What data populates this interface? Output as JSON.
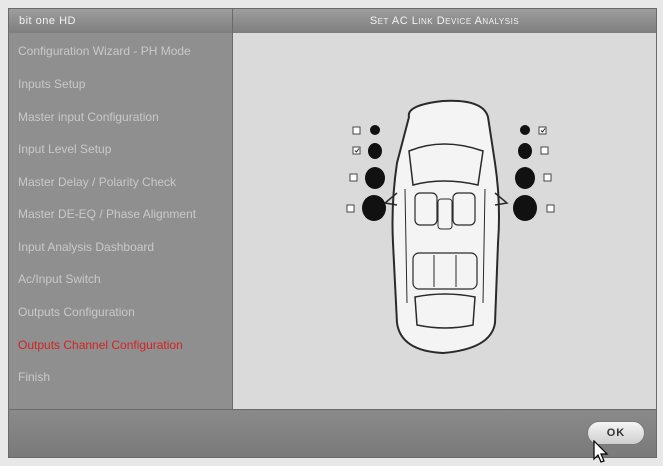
{
  "app": {
    "name": "bit one HD"
  },
  "window": {
    "title": "Set AC Link Device Analysis"
  },
  "sidebar": {
    "items": [
      {
        "label": "Configuration Wizard - PH Mode"
      },
      {
        "label": "Inputs Setup"
      },
      {
        "label": "Master input Configuration"
      },
      {
        "label": "Input Level Setup"
      },
      {
        "label": "Master Delay / Polarity Check"
      },
      {
        "label": "Master DE-EQ / Phase Alignment"
      },
      {
        "label": "Input Analysis Dashboard"
      },
      {
        "label": "Ac/Input Switch"
      },
      {
        "label": "Outputs Configuration"
      },
      {
        "label": "Outputs Channel Configuration",
        "active": true
      },
      {
        "label": "Finish"
      }
    ]
  },
  "speakers": {
    "left": [
      {
        "type": "tweeter",
        "checked": false
      },
      {
        "type": "midrange",
        "checked": true
      },
      {
        "type": "woofer",
        "checked": false
      },
      {
        "type": "subwoofer",
        "checked": false
      }
    ],
    "right": [
      {
        "type": "tweeter",
        "checked": true
      },
      {
        "type": "midrange",
        "checked": false
      },
      {
        "type": "woofer",
        "checked": false
      },
      {
        "type": "subwoofer",
        "checked": false
      }
    ]
  },
  "footer": {
    "ok_label": "OK"
  },
  "colors": {
    "active_item": "#d42323",
    "panel": "#dadada",
    "frame": "#8c8c8c"
  }
}
